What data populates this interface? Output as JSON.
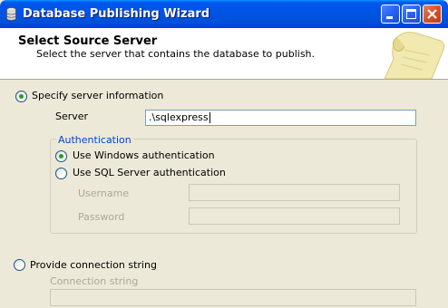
{
  "window": {
    "title": "Database Publishing Wizard"
  },
  "header": {
    "title": "Select Source Server",
    "subtitle": "Select the server that contains the database to publish."
  },
  "specify_server": {
    "label": "Specify server information",
    "selected": true,
    "server_label": "Server",
    "server_value": ".\\sqlexpress"
  },
  "authentication": {
    "group_label": "Authentication",
    "windows_label": "Use Windows authentication",
    "windows_selected": true,
    "sql_label": "Use SQL Server authentication",
    "sql_selected": false,
    "username_label": "Username",
    "username_value": "",
    "password_label": "Password",
    "password_value": ""
  },
  "connection_string": {
    "label": "Provide connection string",
    "selected": false,
    "field_label": "Connection string",
    "field_value": ""
  },
  "icons": {
    "app": "database-icon",
    "header_art": "scroll-icon"
  },
  "colors": {
    "titlebar": "#0053e6",
    "radio_dot": "#21a121",
    "groupbox_label": "#0046d5",
    "disabled_text": "#aca899"
  }
}
